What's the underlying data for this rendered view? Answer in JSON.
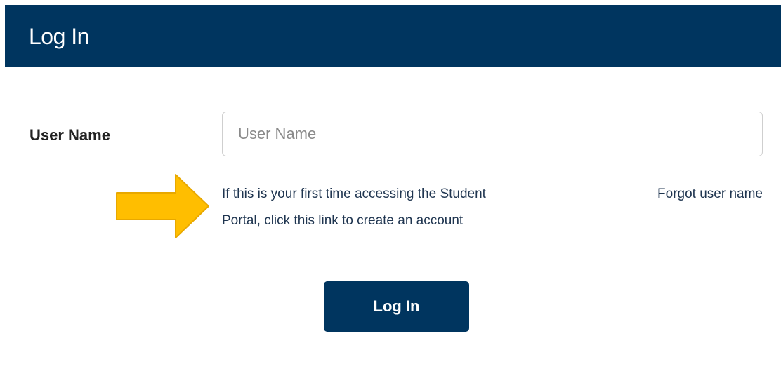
{
  "header": {
    "title": "Log In"
  },
  "form": {
    "username_label": "User Name",
    "username_placeholder": "User Name",
    "username_value": ""
  },
  "links": {
    "create_account": "If this is your first time accessing the Student Portal, click this link to create an account",
    "forgot_username": "Forgot user name"
  },
  "actions": {
    "login_label": "Log In"
  },
  "annotation": {
    "arrow_icon": "right-arrow-icon",
    "arrow_color": "#FFBE00"
  },
  "colors": {
    "brand": "#00355f",
    "link": "#1f3550"
  }
}
